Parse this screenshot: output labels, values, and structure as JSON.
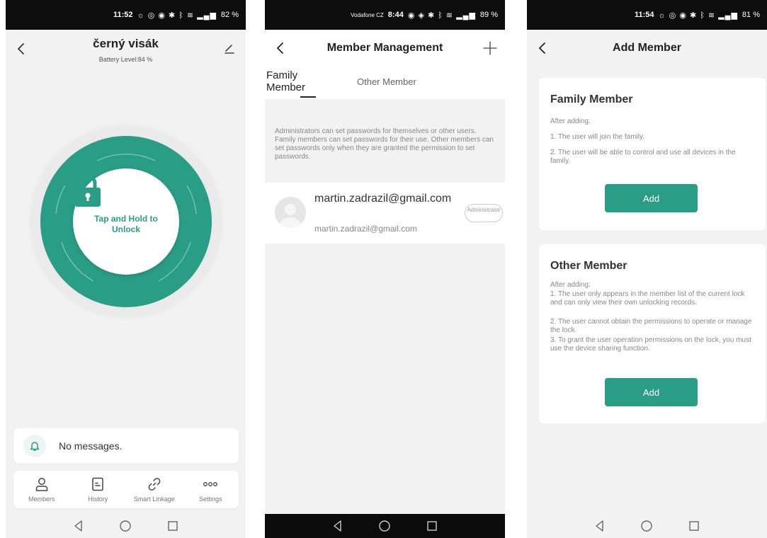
{
  "panel1": {
    "status_time": "11:52",
    "status_icons": "☼ ◎ ◉ ✱ ᛒ ≋ ▂▄▆",
    "status_battery": "82 %",
    "title": "černý visák",
    "battery_level": "Battery Level:84 %",
    "unlock_text": "Tap and Hold to Unlock",
    "message": "No messages.",
    "tabs": [
      {
        "label": "Members",
        "icon": "person-icon"
      },
      {
        "label": "History",
        "icon": "document-icon"
      },
      {
        "label": "Smart Linkage",
        "icon": "link-icon"
      },
      {
        "label": "Settings",
        "icon": "more-icon"
      }
    ]
  },
  "panel2": {
    "status_carrier": "Vodafone CZ",
    "status_time": "8:44",
    "status_icons": "◉ ◈ ✱ ᛒ ≋ ▂▄▆",
    "status_battery": "89 %",
    "title": "Member Management",
    "tab_family": "Family Member",
    "tab_other": "Other Member",
    "info": "Administrators can set passwords for themselves or other users. Family members can set passwords for their use. Other members can set passwords only when they are granted the permission to set passwords.",
    "member": {
      "name": "martin.zadrazil@gmail.com",
      "email": "martin.zadrazil@gmail.com",
      "role": "Administrator"
    }
  },
  "panel3": {
    "status_time": "11:54",
    "status_icons": "☼ ◎ ◉ ✱ ᛒ ≋ ▂▄▆",
    "status_battery": "81 %",
    "title": "Add Member",
    "family": {
      "title": "Family Member",
      "after": "After adding:",
      "line1": "1. The user will join the family.",
      "line2": "2. The user will be able to control and use all devices in the family.",
      "button": "Add"
    },
    "other": {
      "title": "Other Member",
      "after": "After adding:",
      "line1": "1. The user only appears in the member list of the current lock and can only view their own unlocking records.",
      "line2": "2. The user cannot obtain the permissions to operate or manage the lock.",
      "line3": "3. To grant the user operation permissions on the lock, you must use the device sharing function.",
      "button": "Add"
    }
  },
  "colors": {
    "accent": "#2a9d86",
    "statusbar": "#0d0d0d",
    "background": "#f2f2f2"
  }
}
